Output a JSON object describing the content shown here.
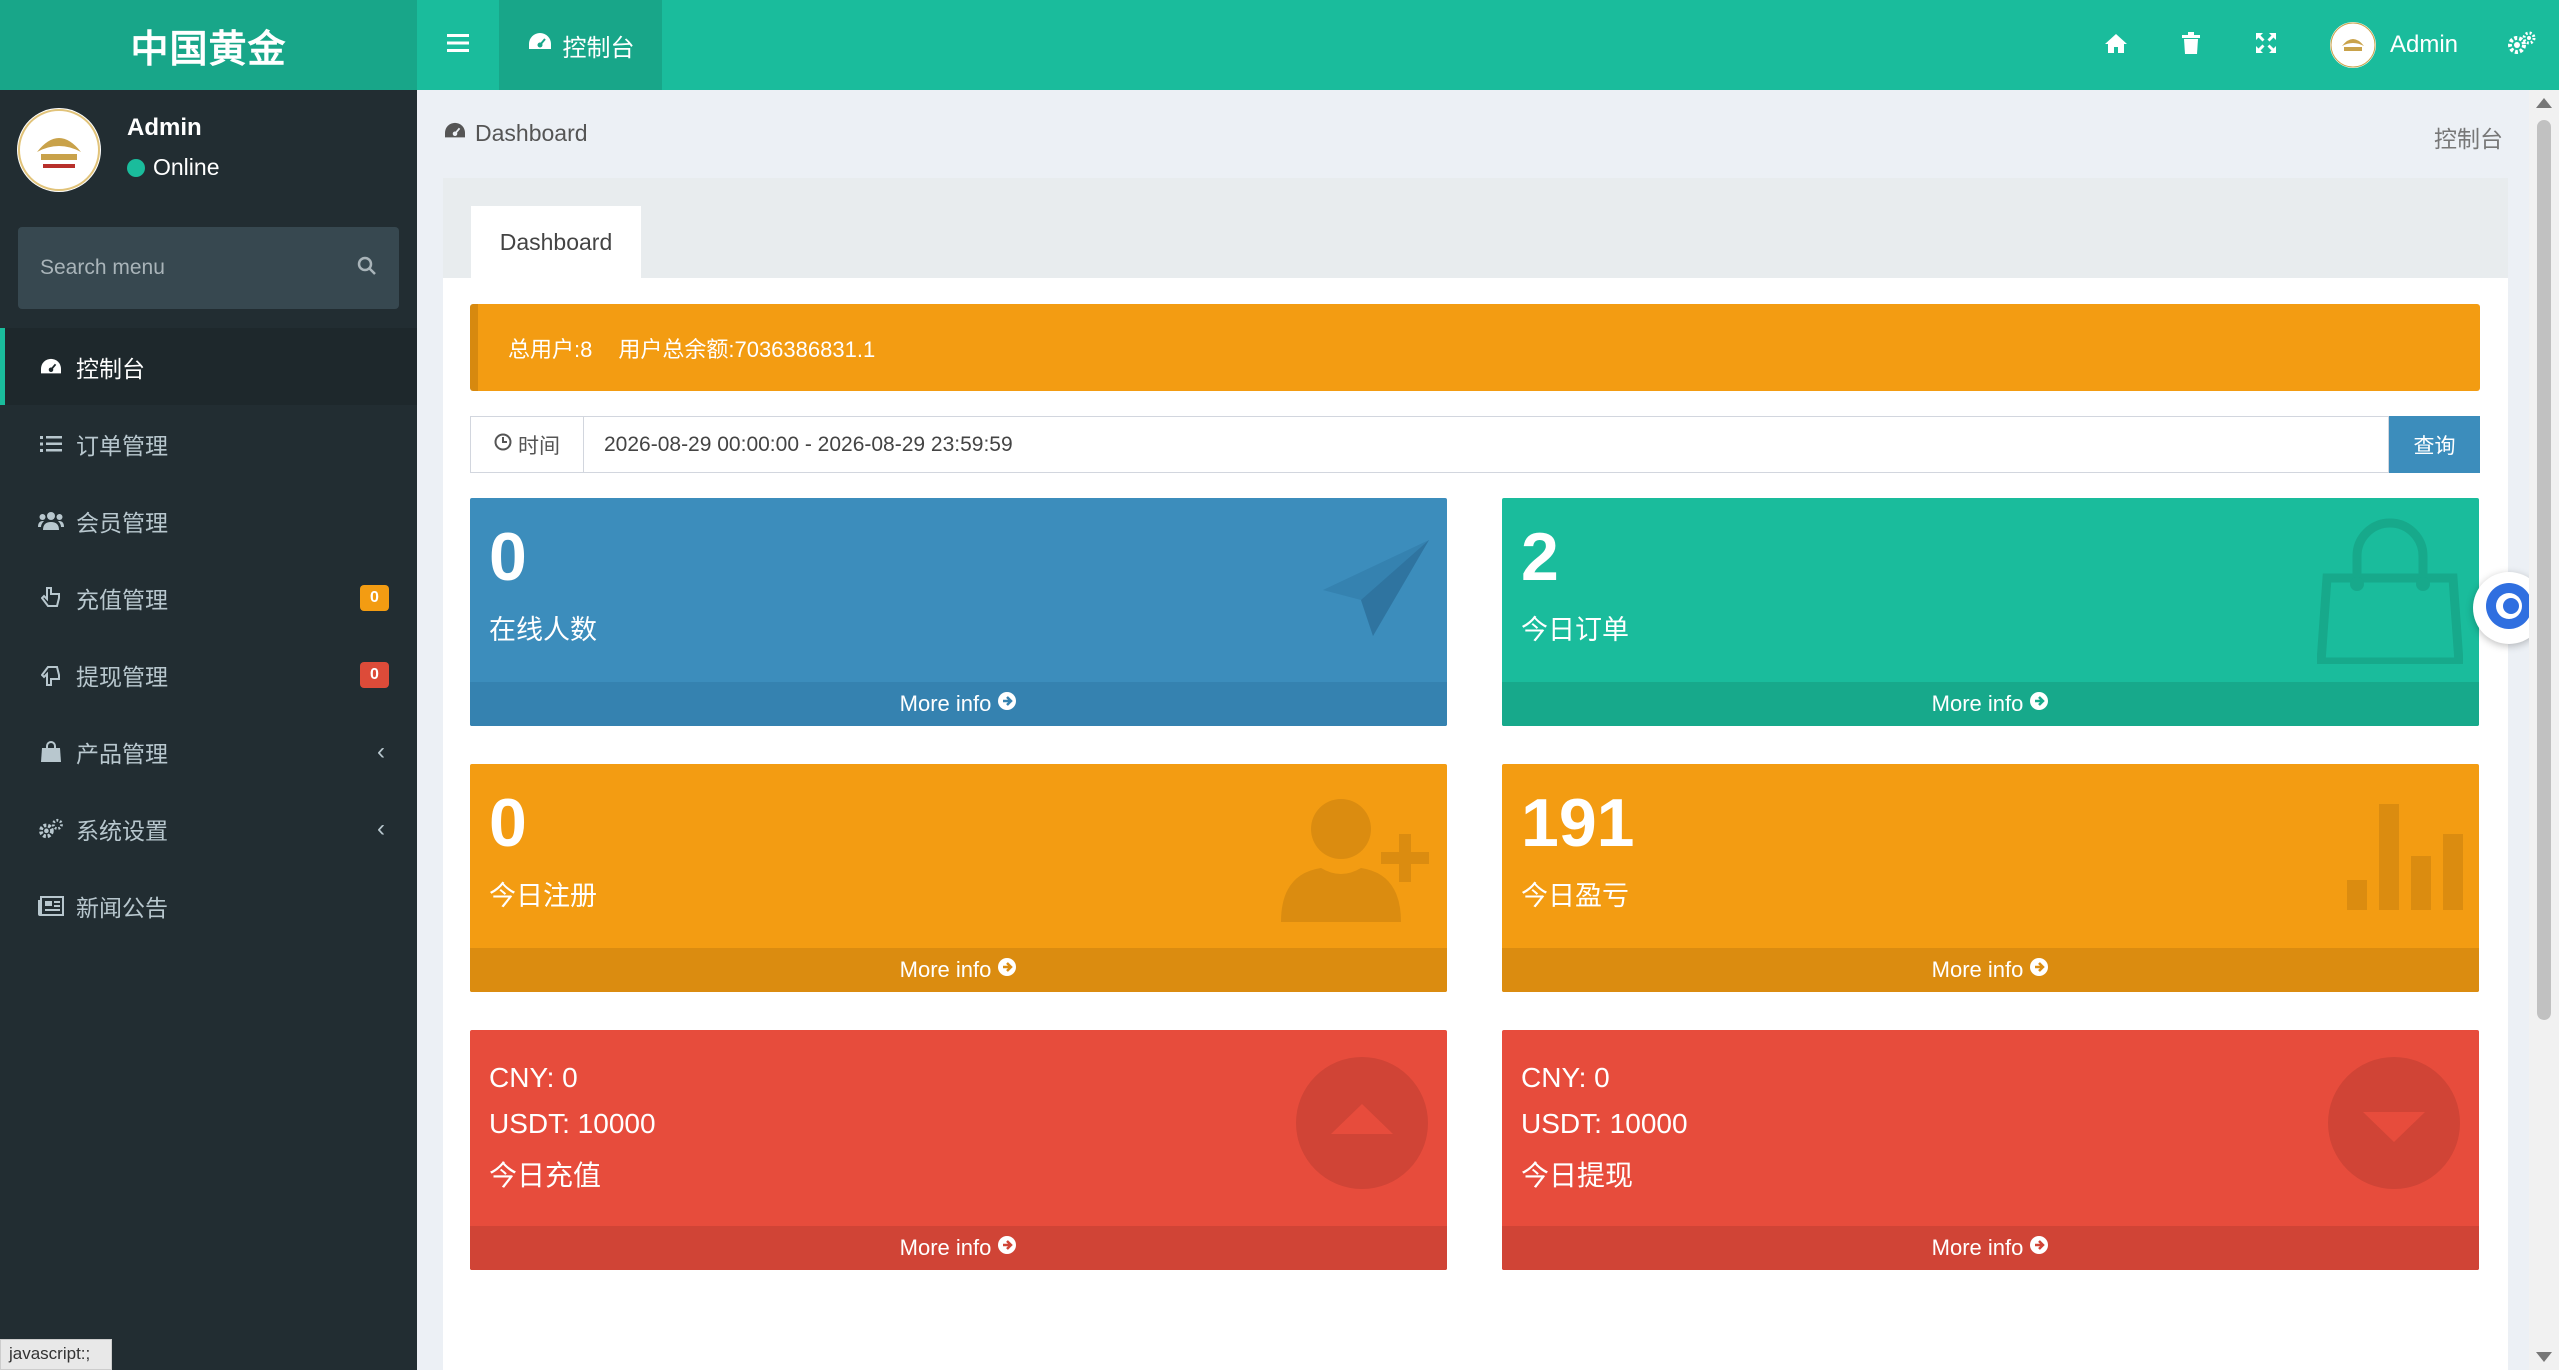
{
  "brand": {
    "title": "中国黄金"
  },
  "header": {
    "active_tab": "控制台",
    "user_name": "Admin",
    "icons": [
      "menu-icon",
      "home-icon",
      "trash-icon",
      "fullscreen-icon",
      "settings-icon"
    ]
  },
  "sidebar": {
    "user": {
      "name": "Admin",
      "status": "Online"
    },
    "search": {
      "placeholder": "Search menu"
    },
    "items": [
      {
        "label": "控制台",
        "icon": "dashboard-icon",
        "active": true
      },
      {
        "label": "订单管理",
        "icon": "list-icon"
      },
      {
        "label": "会员管理",
        "icon": "users-icon"
      },
      {
        "label": "充值管理",
        "icon": "hand-up-icon",
        "badge": "0",
        "badge_color": "#f39c12"
      },
      {
        "label": "提现管理",
        "icon": "hand-down-icon",
        "badge": "0",
        "badge_color": "#dd4b39"
      },
      {
        "label": "产品管理",
        "icon": "shopping-bag-icon",
        "chevron": "‹"
      },
      {
        "label": "系统设置",
        "icon": "cogs-icon",
        "chevron": "‹"
      },
      {
        "label": "新闻公告",
        "icon": "newspaper-icon"
      }
    ]
  },
  "status_bar": {
    "url": "javascript:;"
  },
  "content": {
    "breadcrumb": "Dashboard",
    "breadcrumb_right": "控制台",
    "panel_tab": "Dashboard",
    "alert": {
      "total_users": "总用户:8",
      "total_balance": "用户总余额:7036386831.1"
    },
    "time_filter": {
      "label": "时间",
      "value": "2026-08-29 00:00:00 - 2026-08-29 23:59:59",
      "button": "查询"
    },
    "more_info": "More info",
    "boxes": {
      "online": {
        "value": "0",
        "label": "在线人数",
        "color": "#3c8dbc"
      },
      "orders": {
        "value": "2",
        "label": "今日订单",
        "color": "#1abc9c"
      },
      "registrations": {
        "value": "0",
        "label": "今日注册",
        "color": "#f39c12"
      },
      "profit": {
        "value": "191",
        "label": "今日盈亏",
        "color": "#f39c12"
      },
      "recharge": {
        "cny": "CNY:  0",
        "usdt": "USDT:  10000",
        "label": "今日充值",
        "color": "#e74c3c"
      },
      "withdraw": {
        "cny": "CNY:  0",
        "usdt": "USDT:  10000",
        "label": "今日提现",
        "color": "#e74c3c"
      }
    }
  }
}
